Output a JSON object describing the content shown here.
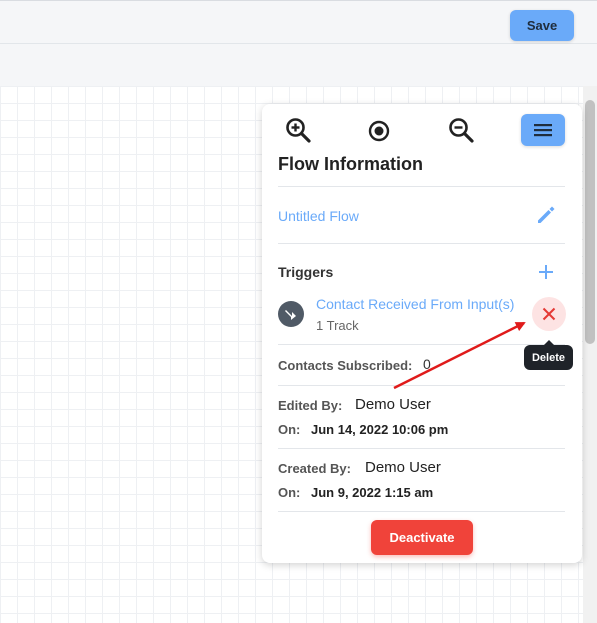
{
  "toolbar": {
    "save_label": "Save"
  },
  "panel": {
    "title": "Flow Information",
    "flow_name": "Untitled Flow",
    "triggers_label": "Triggers",
    "trigger": {
      "name": "Contact Received From Input(s)",
      "tracks": "1 Track"
    },
    "contacts_subscribed_label": "Contacts Subscribed:",
    "contacts_subscribed_value": "0",
    "edited_by_label": "Edited By:",
    "edited_by_value": "Demo User",
    "edited_on_label": "On:",
    "edited_on_value": "Jun 14, 2022 10:06 pm",
    "created_by_label": "Created By:",
    "created_by_value": "Demo User",
    "created_on_label": "On:",
    "created_on_value": "Jun 9, 2022 1:15 am",
    "deactivate_label": "Deactivate"
  },
  "tooltip": {
    "delete_label": "Delete"
  },
  "colors": {
    "accent": "#6aaaf9",
    "danger": "#f0433a",
    "annotation_arrow": "#e01b1b"
  },
  "icons": [
    "zoom-in-icon",
    "center-icon",
    "zoom-out-icon",
    "menu-icon",
    "pencil-icon",
    "plus-icon",
    "trigger-icon",
    "close-icon"
  ]
}
